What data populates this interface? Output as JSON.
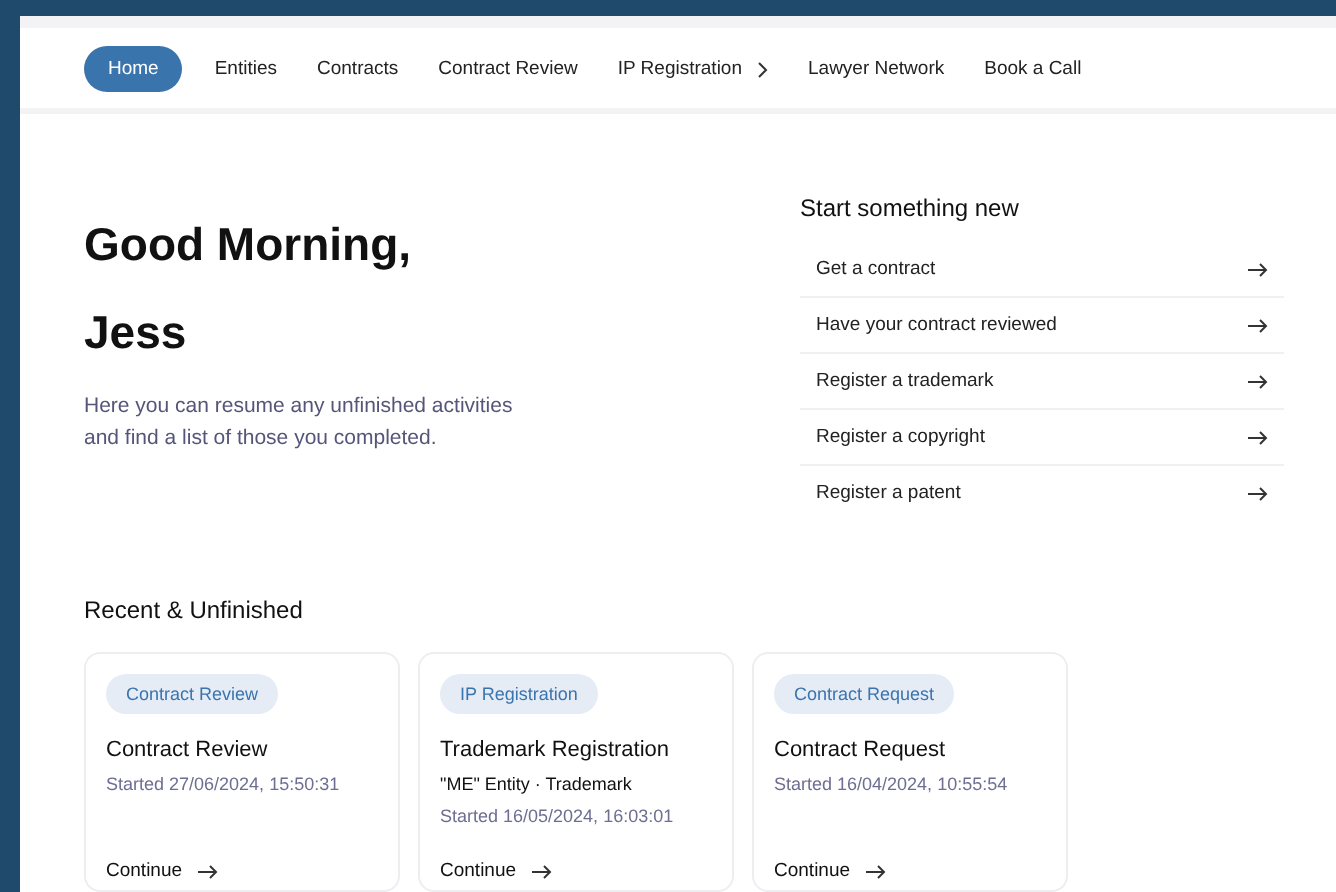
{
  "nav": [
    {
      "label": "Home",
      "selected": true,
      "has_submenu": false
    },
    {
      "label": "Entities",
      "selected": false,
      "has_submenu": false
    },
    {
      "label": "Contracts",
      "selected": false,
      "has_submenu": false
    },
    {
      "label": "Contract Review",
      "selected": false,
      "has_submenu": false
    },
    {
      "label": "IP Registration",
      "selected": false,
      "has_submenu": true
    },
    {
      "label": "Lawyer Network",
      "selected": false,
      "has_submenu": false
    },
    {
      "label": "Book a Call",
      "selected": false,
      "has_submenu": false
    }
  ],
  "greeting": {
    "title": "Good Morning,",
    "name": "Jess",
    "description": "Here you can resume any unfinished activities and find a list of those you completed."
  },
  "start_new": {
    "title": "Start something new",
    "items": [
      "Get a contract",
      "Have your contract reviewed",
      "Register a trademark",
      "Register a copyright",
      "Register a patent"
    ]
  },
  "recent": {
    "title": "Recent & Unfinished",
    "cards": [
      {
        "tag": "Contract Review",
        "title": "Contract Review",
        "started": "Started 27/06/2024, 15:50:31",
        "action": "Continue"
      },
      {
        "tag": "IP Registration",
        "title": "Trademark Registration",
        "subtitle": "\"ME\" Entity · Trademark",
        "started": "Started 16/05/2024, 16:03:01",
        "action": "Continue"
      },
      {
        "tag": "Contract Request",
        "title": "Contract Request",
        "started": "Started 16/04/2024, 10:55:54",
        "action": "Continue"
      }
    ]
  }
}
